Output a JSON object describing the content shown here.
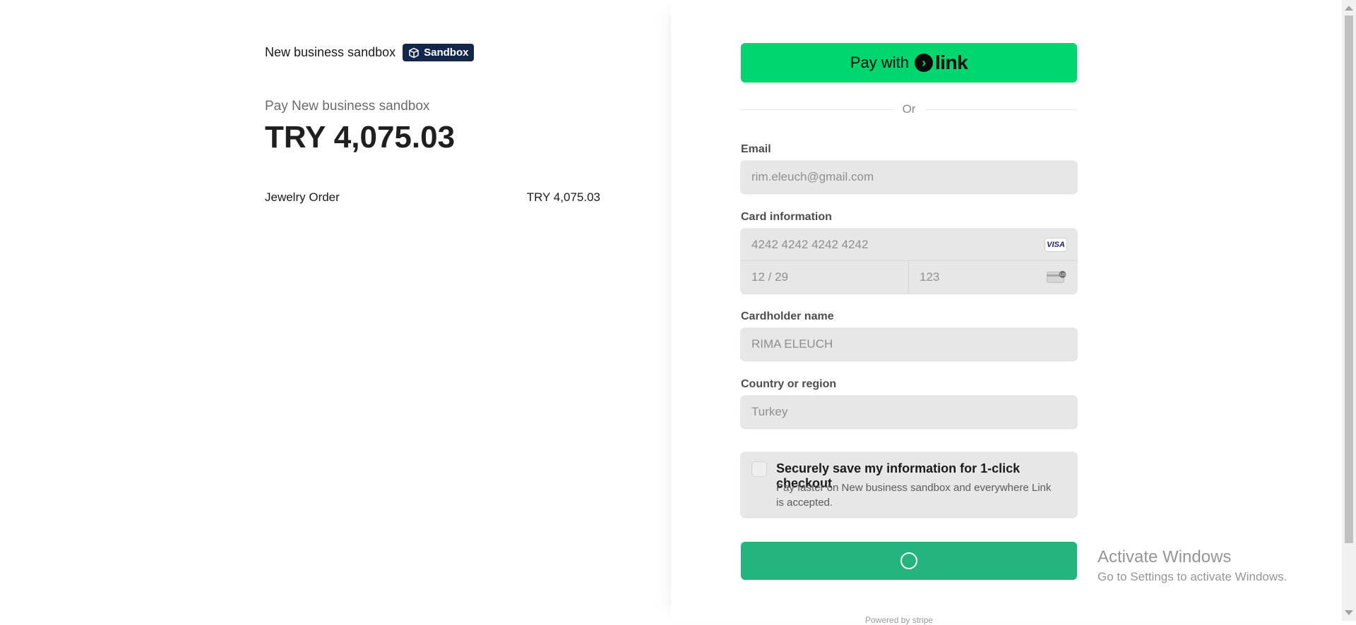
{
  "merchant": {
    "name": "New business sandbox",
    "badge": "Sandbox",
    "pay_label": "Pay New business sandbox",
    "amount": "TRY 4,075.03"
  },
  "line_items": [
    {
      "name": "Jewelry Order",
      "price": "TRY 4,075.03"
    }
  ],
  "link_button": {
    "prefix": "Pay with",
    "brand": "link"
  },
  "divider": "Or",
  "form": {
    "email": {
      "label": "Email",
      "value": "rim.eleuch@gmail.com"
    },
    "card": {
      "label": "Card information",
      "number": "4242 4242 4242 4242",
      "brand": "VISA",
      "expiry": "12 / 29",
      "cvc": "123"
    },
    "cardholder": {
      "label": "Cardholder name",
      "value": "RIMA ELEUCH"
    },
    "country": {
      "label": "Country or region",
      "value": "Turkey"
    }
  },
  "save_info": {
    "title": "Securely save my information for 1-click checkout",
    "description": "Pay faster on New business sandbox and everywhere Link is accepted."
  },
  "footer": {
    "powered": "Powered by stripe"
  },
  "watermark": {
    "title": "Activate Windows",
    "subtitle": "Go to Settings to activate Windows."
  },
  "colors": {
    "link_green": "#00d66f",
    "pay_button": "#24b47e",
    "badge_bg": "#14264a"
  }
}
